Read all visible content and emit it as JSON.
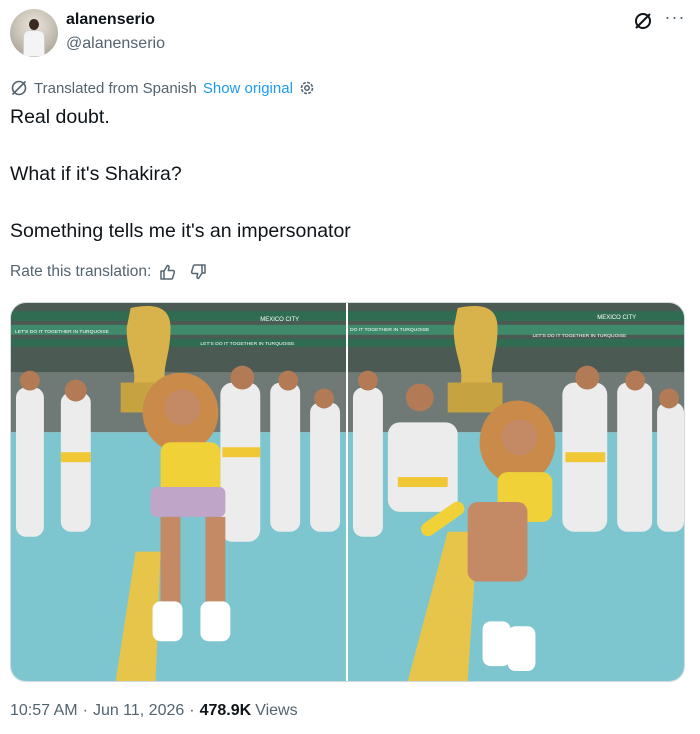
{
  "author": {
    "display_name": "alanenserio",
    "handle": "@alanenserio"
  },
  "header_icons": {
    "grok": "grok-icon",
    "more": "···"
  },
  "translation": {
    "label": "Translated from Spanish",
    "show_original": "Show original",
    "settings_icon": "gear-icon",
    "rate_label": "Rate this translation:",
    "thumbs": [
      "thumbs-up-icon",
      "thumbs-down-icon"
    ]
  },
  "tweet": {
    "paragraphs": [
      "Real doubt.",
      "What if it's Shakira?",
      "Something tells me it's an impersonator"
    ]
  },
  "media": {
    "images": [
      {
        "banner_texts": [
          "MEXICO CITY",
          "LET'S DO IT TOGETHER IN TURQUOISE",
          "LET'S DO IT TOGETHER IN TURQUOISE"
        ]
      },
      {
        "banner_texts": [
          "MEXICO CITY",
          "DO IT TOGETHER IN TURQUOISE",
          "LET'S DO IT TOGETHER IN TURQUOISE"
        ]
      }
    ]
  },
  "meta": {
    "time": "10:57 AM",
    "separator": "·",
    "date": "Jun 11, 2026",
    "views_count": "478.9K",
    "views_label": "Views"
  },
  "colors": {
    "accent": "#1d9bf0",
    "secondary_text": "#536471",
    "primary_text": "#0f1419",
    "field": "#7ec6cf",
    "gold": "#d8b24a"
  }
}
